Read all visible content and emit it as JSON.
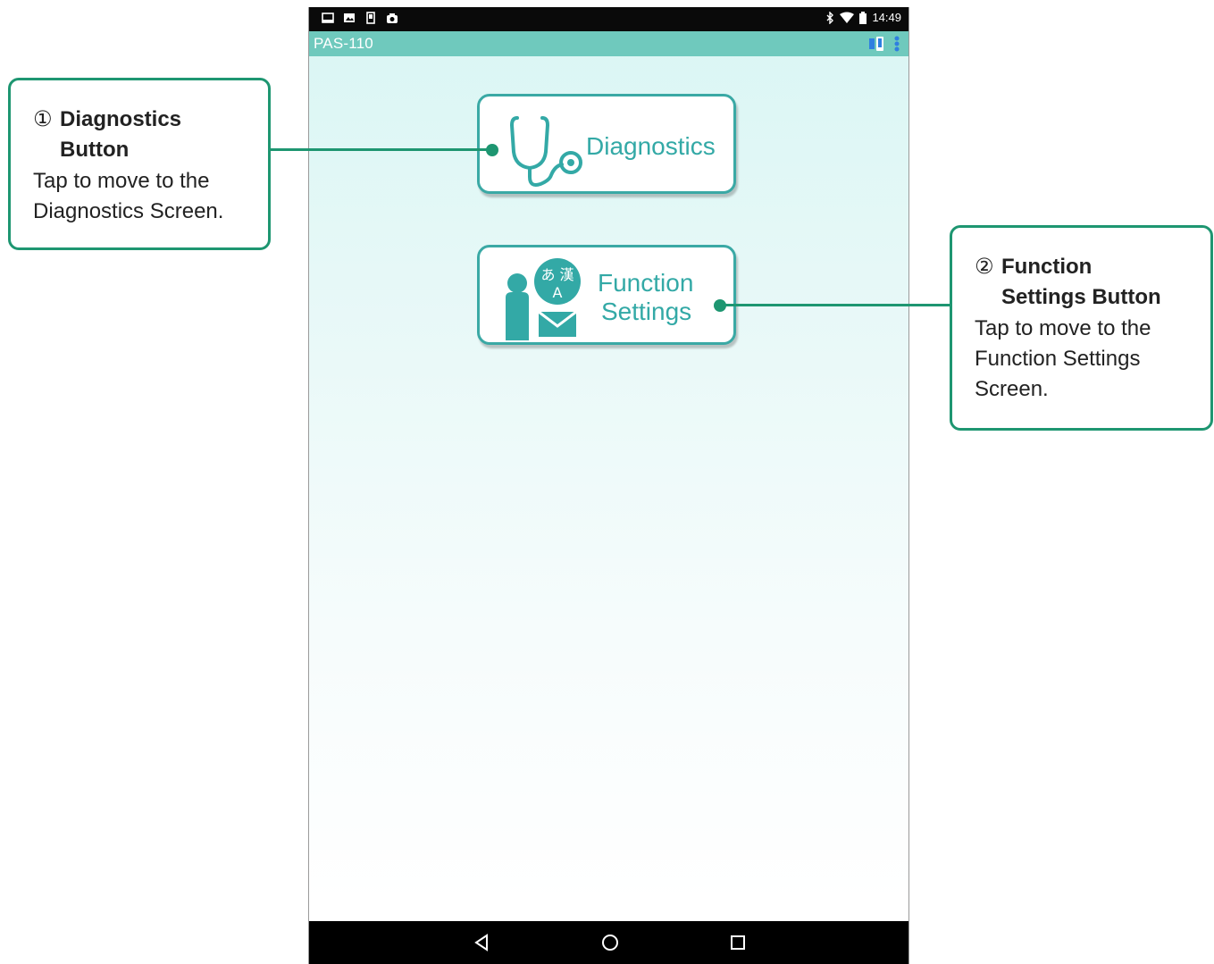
{
  "status_bar": {
    "time": "14:49"
  },
  "app_bar": {
    "title": "PAS-110"
  },
  "buttons": {
    "diagnostics": "Diagnostics",
    "function_line1": "Function",
    "function_line2": "Settings",
    "function_icon_text": "あ 漢",
    "function_icon_letter": "A"
  },
  "callouts": [
    {
      "number": "①",
      "title": "Diagnostics\nButton",
      "description": "Tap to move to the\nDiagnostics Screen."
    },
    {
      "number": "②",
      "title": "Function\nSettings Button",
      "description": "Tap to move to the\nFunction Settings\nScreen."
    }
  ],
  "colors": {
    "accent": "#33a9a6",
    "app_bar": "#6fc9bd",
    "callout": "#1e9671"
  },
  "icons": [
    "stethoscope-icon",
    "person-language-mail-icon",
    "back-icon",
    "home-icon",
    "recents-icon"
  ]
}
